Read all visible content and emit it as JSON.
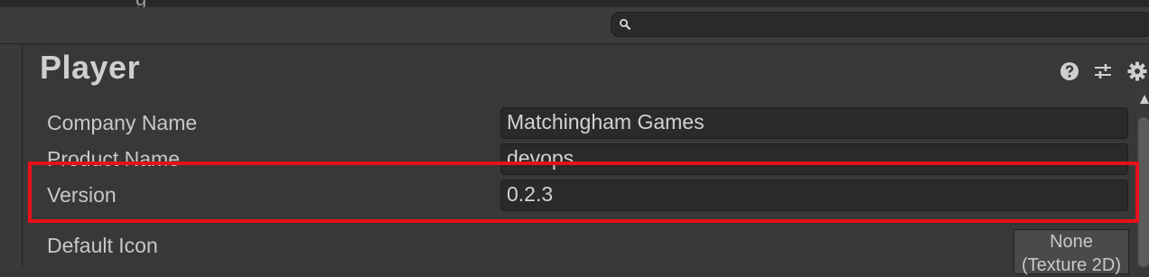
{
  "header": {
    "partial_text": "g",
    "title": "Player"
  },
  "search": {
    "placeholder": "",
    "value": ""
  },
  "toolbar_icons": [
    "help-icon",
    "presets-icon",
    "settings-icon"
  ],
  "fields": [
    {
      "label": "Company Name",
      "value": "Matchingham Games"
    },
    {
      "label": "Product Name",
      "value": "devops"
    },
    {
      "label": "Version",
      "value": "0.2.3"
    }
  ],
  "default_icon": {
    "label": "Default Icon",
    "line1": "None",
    "line2": "(Texture 2D)"
  },
  "colors": {
    "highlight": "#e8101a",
    "background": "#383838",
    "field_bg": "#2a2a2a"
  }
}
